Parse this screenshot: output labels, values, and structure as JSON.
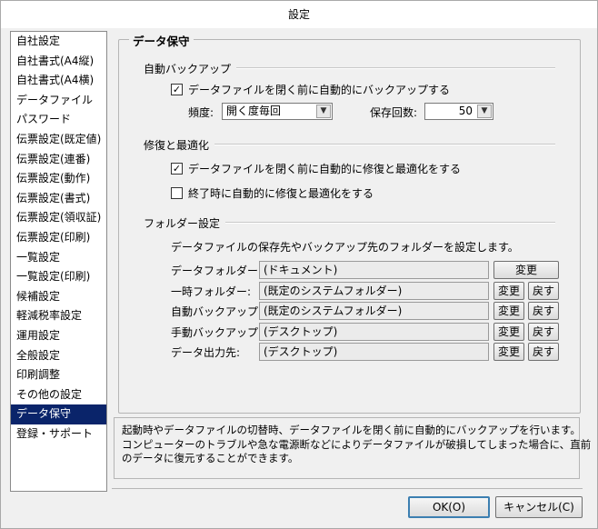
{
  "window": {
    "title": "設定"
  },
  "sidebar": {
    "items": [
      {
        "label": "自社設定"
      },
      {
        "label": "自社書式(A4縦)"
      },
      {
        "label": "自社書式(A4横)"
      },
      {
        "label": "データファイル"
      },
      {
        "label": "パスワード"
      },
      {
        "label": "伝票設定(既定値)"
      },
      {
        "label": "伝票設定(連番)"
      },
      {
        "label": "伝票設定(動作)"
      },
      {
        "label": "伝票設定(書式)"
      },
      {
        "label": "伝票設定(領収証)"
      },
      {
        "label": "伝票設定(印刷)"
      },
      {
        "label": "一覧設定"
      },
      {
        "label": "一覧設定(印刷)"
      },
      {
        "label": "候補設定"
      },
      {
        "label": "軽減税率設定"
      },
      {
        "label": "運用設定"
      },
      {
        "label": "全般設定"
      },
      {
        "label": "印刷調整"
      },
      {
        "label": "その他の設定"
      },
      {
        "label": "データ保守"
      },
      {
        "label": "登録・サポート"
      }
    ],
    "selected_index": 19
  },
  "panel": {
    "title": "データ保守",
    "auto_backup": {
      "section_title": "自動バックアップ",
      "checkbox_label": "データファイルを閉く前に自動的にバックアップする",
      "checked": true,
      "frequency_label": "頻度:",
      "frequency_value": "開く度毎回",
      "count_label": "保存回数:",
      "count_value": "50"
    },
    "repair": {
      "section_title": "修復と最適化",
      "opt1_label": "データファイルを閉く前に自動的に修復と最適化をする",
      "opt1_checked": true,
      "opt2_label": "終了時に自動的に修復と最適化をする",
      "opt2_checked": false
    },
    "folders": {
      "section_title": "フォルダー設定",
      "description": "データファイルの保存先やバックアップ先のフォルダーを設定します。",
      "rows": [
        {
          "label": "データフォルダー:",
          "value": "(ドキュメント)",
          "change": "変更",
          "reset": ""
        },
        {
          "label": "一時フォルダー:",
          "value": "(既定のシステムフォルダー)",
          "change": "変更",
          "reset": "戻す"
        },
        {
          "label": "自動バックアップ:",
          "value": "(既定のシステムフォルダー)",
          "change": "変更",
          "reset": "戻す"
        },
        {
          "label": "手動バックアップ:",
          "value": "(デスクトップ)",
          "change": "変更",
          "reset": "戻す"
        },
        {
          "label": "データ出力先:",
          "value": "(デスクトップ)",
          "change": "変更",
          "reset": "戻す"
        }
      ]
    }
  },
  "description_box": {
    "lines": [
      "起動時やデータファイルの切替時、データファイルを閉く前に自動的にバックアップを行います。",
      "コンピューターのトラブルや急な電源断などによりデータファイルが破損してしまった場合に、直前",
      "のデータに復元することができます。"
    ]
  },
  "footer": {
    "ok_label": "OK(O)",
    "cancel_label": "キャンセル(C)"
  }
}
